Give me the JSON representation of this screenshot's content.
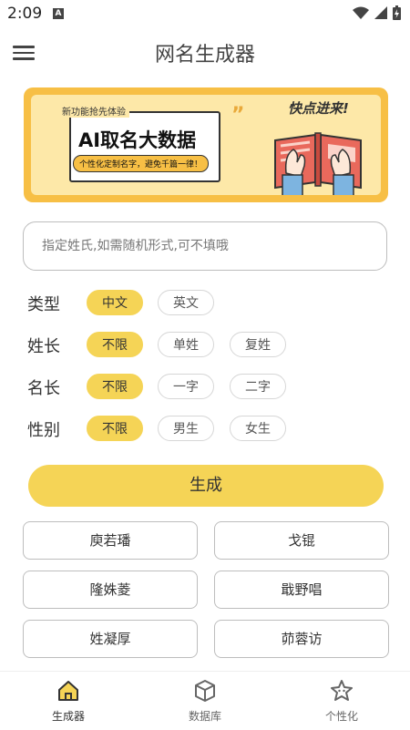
{
  "status": {
    "time": "2:09",
    "notif": "A"
  },
  "app": {
    "title": "网名生成器"
  },
  "banner": {
    "tag": "新功能抢先体验",
    "headline": "AI取名大数据",
    "slogan": "个性化定制名字，避免千篇一律！",
    "right_text": "快点进来!",
    "quote_mark": "”"
  },
  "search": {
    "placeholder": "指定姓氏,如需随机形式,可不填哦",
    "value": ""
  },
  "options": [
    {
      "label": "类型",
      "choices": [
        "中文",
        "英文"
      ],
      "selected": "中文"
    },
    {
      "label": "姓长",
      "choices": [
        "不限",
        "单姓",
        "复姓"
      ],
      "selected": "不限"
    },
    {
      "label": "名长",
      "choices": [
        "不限",
        "一字",
        "二字"
      ],
      "selected": "不限"
    },
    {
      "label": "性别",
      "choices": [
        "不限",
        "男生",
        "女生"
      ],
      "selected": "不限"
    }
  ],
  "generate_label": "生成",
  "results": [
    "庾若璠",
    "戈锟",
    "隆姝菱",
    "戢野唱",
    "姓凝厚",
    "茆蓉访"
  ],
  "nav": [
    {
      "label": "生成器",
      "icon": "home-icon",
      "active": true
    },
    {
      "label": "数据库",
      "icon": "cube-icon",
      "active": false
    },
    {
      "label": "个性化",
      "icon": "star-face-icon",
      "active": false
    }
  ],
  "colors": {
    "accent": "#f5d456",
    "banner_border": "#f7bf45",
    "banner_bg": "#fde8a8"
  }
}
